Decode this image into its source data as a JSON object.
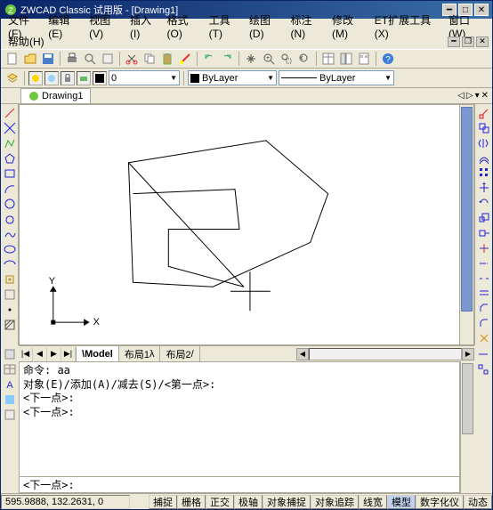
{
  "window": {
    "title": "ZWCAD Classic 试用版 - [Drawing1]"
  },
  "menu": {
    "items": [
      "文件(F)",
      "编辑(E)",
      "视图(V)",
      "插入(I)",
      "格式(O)",
      "工具(T)",
      "绘图(D)",
      "标注(N)",
      "修改(M)",
      "ET扩展工具(X)",
      "窗口(W)",
      "帮助(H)"
    ]
  },
  "toolbar": {
    "layer_value": "0",
    "color_value": "ByLayer",
    "ltype_value": "ByLayer"
  },
  "doc_tab": {
    "name": "Drawing1"
  },
  "layout_tabs": {
    "items": [
      "Model",
      "布局1",
      "布局2"
    ]
  },
  "command": {
    "history_lines": [
      "命令: aa",
      "对象(E)/添加(A)/减去(S)/<第一点>:",
      "<下一点>:",
      "<下一点>:"
    ],
    "input": "<下一点>:"
  },
  "status": {
    "coords": "595.9888, 132.2631, 0",
    "toggles": [
      "捕捉",
      "栅格",
      "正交",
      "极轴",
      "对象捕捉",
      "对象追踪",
      "线宽",
      "模型",
      "数字化仪",
      "动态"
    ]
  },
  "icons": {
    "app": "Z",
    "pin": "📌"
  },
  "axes": {
    "x": "X",
    "y": "Y"
  }
}
